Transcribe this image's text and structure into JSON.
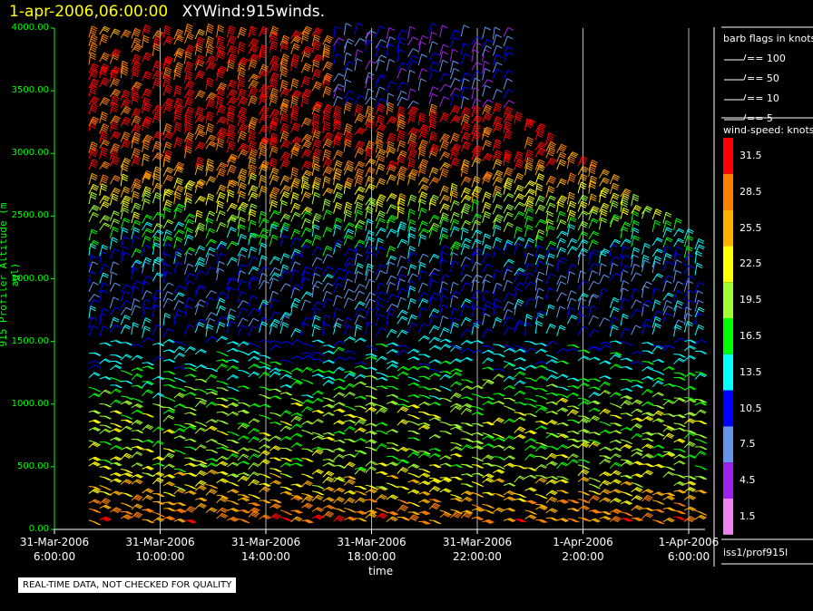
{
  "title": {
    "date": "1-apr-2006,06:00:00",
    "text": "XYWind:915winds."
  },
  "notice": "REAL-TIME DATA, NOT CHECKED FOR QUALITY",
  "source": "iss1/prof915l",
  "legend": {
    "barb_title": "barb flags in knots",
    "barb_flags": [
      "== 100",
      "== 50",
      "== 10",
      "== 5"
    ],
    "speed_title": "wind-speed: knots",
    "speed_bins": [
      {
        "label": "31.5",
        "color": "#ff0000"
      },
      {
        "label": "28.5",
        "color": "#ff8000"
      },
      {
        "label": "25.5",
        "color": "#ffb000"
      },
      {
        "label": "22.5",
        "color": "#ffff00"
      },
      {
        "label": "19.5",
        "color": "#a0ff30"
      },
      {
        "label": "16.5",
        "color": "#00ff00"
      },
      {
        "label": "13.5",
        "color": "#00ffff"
      },
      {
        "label": "10.5",
        "color": "#0000ff"
      },
      {
        "label": "7.5",
        "color": "#6495ed"
      },
      {
        "label": "4.5",
        "color": "#a020f0"
      },
      {
        "label": "1.5",
        "color": "#ee82ee"
      }
    ]
  },
  "chart_data": {
    "type": "scatter",
    "title": "XYWind:915winds.",
    "xlabel": "time",
    "ylabel": "915 Profiler Altitude (m agl)",
    "ylim": [
      0,
      4000
    ],
    "y_ticks": [
      "4000.00",
      "3500.00",
      "3000.00",
      "2500.00",
      "2000.00",
      "1500.00",
      "1000.00",
      "500.00",
      "0.00"
    ],
    "x_ticks": [
      {
        "date": "31-Mar-2006",
        "time": "6:00:00"
      },
      {
        "date": "31-Mar-2006",
        "time": "10:00:00"
      },
      {
        "date": "31-Mar-2006",
        "time": "14:00:00"
      },
      {
        "date": "31-Mar-2006",
        "time": "18:00:00"
      },
      {
        "date": "31-Mar-2006",
        "time": "22:00:00"
      },
      {
        "date": "1-Apr-2006",
        "time": "2:00:00"
      },
      {
        "date": "1-Apr-2006",
        "time": "6:00:00"
      }
    ],
    "grid": true,
    "profile": [
      {
        "z": 100,
        "speed": 28
      },
      {
        "z": 300,
        "speed": 24
      },
      {
        "z": 500,
        "speed": 20
      },
      {
        "z": 700,
        "speed": 19
      },
      {
        "z": 900,
        "speed": 20
      },
      {
        "z": 1100,
        "speed": 17
      },
      {
        "z": 1300,
        "speed": 14
      },
      {
        "z": 1500,
        "speed": 12
      },
      {
        "z": 1700,
        "speed": 10
      },
      {
        "z": 1900,
        "speed": 9
      },
      {
        "z": 2100,
        "speed": 11
      },
      {
        "z": 2300,
        "speed": 15
      },
      {
        "z": 2500,
        "speed": 20
      },
      {
        "z": 2700,
        "speed": 25
      },
      {
        "z": 2900,
        "speed": 29
      },
      {
        "z": 3100,
        "speed": 31
      },
      {
        "z": 3300,
        "speed": 32
      },
      {
        "z": 3500,
        "speed": 31
      },
      {
        "z": 3700,
        "speed": 30
      },
      {
        "z": 3900,
        "speed": 29
      }
    ]
  }
}
